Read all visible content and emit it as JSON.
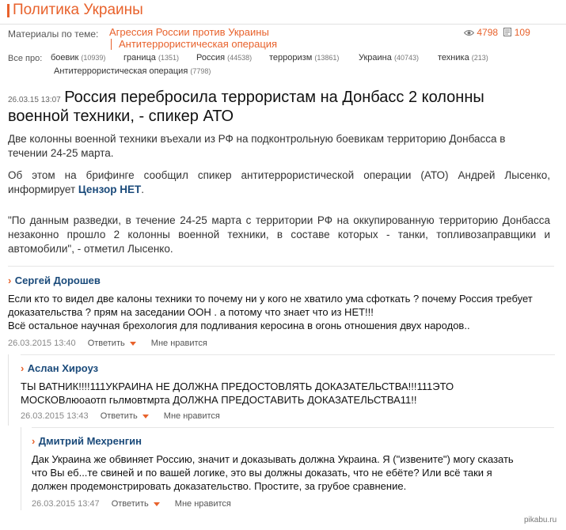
{
  "section": {
    "title": "Политика Украины"
  },
  "topics": {
    "label": "Материалы по теме:",
    "items": [
      "Агрессия России против Украины",
      "Антитеррористическая операция"
    ]
  },
  "stats": {
    "views": "4798",
    "comments": "109"
  },
  "tags": {
    "label": "Все про:",
    "items": [
      {
        "name": "боевик",
        "count": "(10939)"
      },
      {
        "name": "граница",
        "count": "(1351)"
      },
      {
        "name": "Россия",
        "count": "(44538)"
      },
      {
        "name": "терроризм",
        "count": "(13861)"
      },
      {
        "name": "Украина",
        "count": "(40743)"
      },
      {
        "name": "техника",
        "count": "(213)"
      },
      {
        "name": "Антитеррористическая операция",
        "count": "(7798)"
      }
    ]
  },
  "article": {
    "date": "26.03.15 13:07",
    "title": "Россия перебросила террористам на Донбасс 2 колонны военной техники, - спикер АТО",
    "lead": "Две колонны военной техники въехали из РФ на подконтрольную боевикам территорию Донбасса в течении 24-25 марта.",
    "para2": "Об этом на брифинге сообщил спикер антитеррористической операции (АТО) Андрей Лысенко, информирует",
    "source": "Цензор НЕТ",
    "para2_end": ".",
    "quote": "\"По данным разведки, в течение 24-25 марта с территории РФ на оккупированную территорию Донбасса незаконно прошло 2 колонны военной техники, в составе которых - танки, топливозаправщики и автомобили\", - отметил Лысенко."
  },
  "comment_labels": {
    "reply": "Ответить",
    "like": "Мне нравится",
    "mark": "›"
  },
  "comments": [
    {
      "author": "Сергей Дорошев",
      "text1": "Если кто то видел две калоны техники то почему ни у кого не хватило ума сфоткать ? почему Россия требует доказательства ? прям на заседании ООН . а потому что знает что из НЕТ!!!",
      "text2": "Всё остальное научная брехология для подливания керосина в огонь отношения двух народов..",
      "date": "26.03.2015 13:40"
    },
    {
      "author": "Аслан Хироуз",
      "text1": "ТЫ ВАТНИК!!!!111УКРАИНА НЕ ДОЛЖНА ПРЕДОСТОВЛЯТЬ ДОКАЗАТЕЛЬСТВА!!!111ЭТО МОСКОВлюоаотп гьлмовтмрта ДОЛЖНА ПРЕДОСТАВИТЬ ДОКАЗАТЕЛЬСТВА11!!",
      "date": "26.03.2015 13:43"
    },
    {
      "author": "Дмитрий Мехренгин",
      "text1": "Дак Украина же обвиняет Россию, значит и доказывать должна Украина. Я (\"извените\") могу сказать что Вы еб...те свиней и по вашей логике, это вы должны доказать, что не ебёте? Или всё таки я должен продемонстрировать доказательство. Простите, за грубое сравнение.",
      "date": "26.03.2015 13:47"
    }
  ],
  "watermark": "pikabu.ru"
}
